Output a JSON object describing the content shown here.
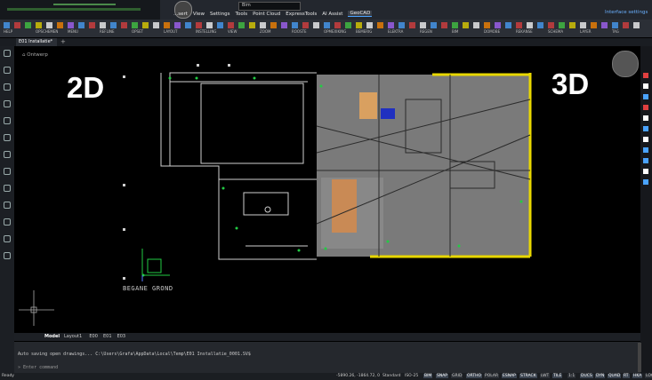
{
  "app": {
    "menu": [
      "...sert",
      "View",
      "Settings",
      "Tools",
      "Point Cloud",
      "ExpressTools",
      "AI Assist",
      "GeoCAD"
    ],
    "active_menu": "GeoCAD",
    "dropdown_value": "Bim",
    "interface_settings": "Interface settings"
  },
  "ribbon": {
    "groups": [
      "HELP",
      "OPSCHEMEN",
      "MENU",
      "REFLINE",
      "OPSET",
      "LAYOUT",
      "INSTELLING",
      "VIEW",
      "ZOOM",
      "ROOSTE",
      "OPMEXIKING",
      "BEMERIG",
      "ELEKTRA",
      "REGEN",
      "BIM",
      "DOMOBE",
      "REKANSE",
      "SCHEMA",
      "LAYER",
      "TAG"
    ]
  },
  "file_tab": {
    "label": "E01 Installatie*",
    "close": "×",
    "add": "+"
  },
  "canvas": {
    "breadcrumb": "Ontwerp",
    "label_2d": "2D",
    "label_3d": "3D",
    "floor_label": "BEGANE GROND"
  },
  "layout_tabs": [
    "Model",
    "Layout1",
    "E00",
    "E01",
    "E03"
  ],
  "command": {
    "log": "Auto saving open drawings... C:\\Users\\Grafa\\AppData\\Local\\Temp\\E01 Installatie_0001.SV$",
    "prompt": "Enter command"
  },
  "status": {
    "ready": "Ready",
    "coords": "-5890.26, -1864.72, 0",
    "standard": "Standard",
    "iso": "ISO-25",
    "items": [
      "BIM",
      "SNAP",
      "GRID",
      "ORTHO",
      "POLAR",
      "ESNAP",
      "STRACK",
      "LWT",
      "TILE",
      "1:1",
      "DUCS",
      "DYN",
      "QUAD",
      "RT",
      "HKA",
      "LOCKUI",
      "None"
    ],
    "active_items": [
      "BIM",
      "SNAP",
      "ORTHO",
      "ESNAP",
      "STRACK",
      "TILE",
      "DUCS",
      "DYN",
      "QUAD",
      "RT",
      "HKA"
    ]
  },
  "colors": {
    "accent": "#4aa3ff",
    "wall_yellow": "#e8d700",
    "floor_3d": "#7a7a7a",
    "table_wood": "#c98a55"
  }
}
